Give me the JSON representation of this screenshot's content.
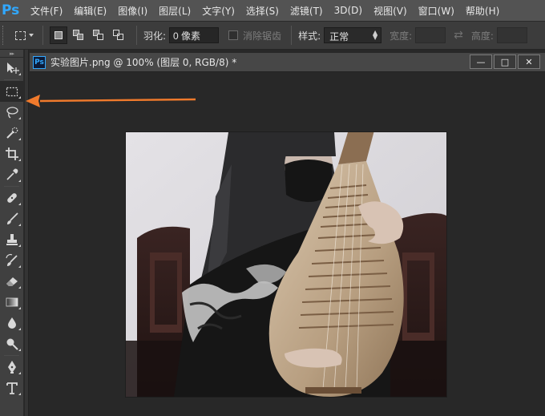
{
  "app": {
    "logo": "Ps"
  },
  "menu": [
    "文件(F)",
    "编辑(E)",
    "图像(I)",
    "图层(L)",
    "文字(Y)",
    "选择(S)",
    "滤镜(T)",
    "3D(D)",
    "视图(V)",
    "窗口(W)",
    "帮助(H)"
  ],
  "options": {
    "feather_label": "羽化:",
    "feather_value": "0 像素",
    "antialias_label": "消除锯齿",
    "style_label": "样式:",
    "style_value": "正常",
    "width_label": "宽度:",
    "height_label": "高度:"
  },
  "document": {
    "icon_text": "Ps",
    "title": "实验图片.png @ 100% (图层 0, RGB/8) *",
    "minimize": "—",
    "maximize": "□",
    "close": "✕"
  },
  "colors": {
    "annotation_arrow": "#f07a2c",
    "ps_blue": "#31a8ff"
  },
  "toolbar": {
    "tools": [
      "move-tool",
      "marquee-tool",
      "lasso-tool",
      "quick-selection-tool",
      "crop-tool",
      "eyedropper-tool",
      "healing-brush-tool",
      "brush-tool",
      "clone-stamp-tool",
      "history-brush-tool",
      "eraser-tool",
      "gradient-tool",
      "blur-tool",
      "dodge-tool",
      "pen-tool",
      "type-tool"
    ],
    "selected": "marquee-tool"
  }
}
